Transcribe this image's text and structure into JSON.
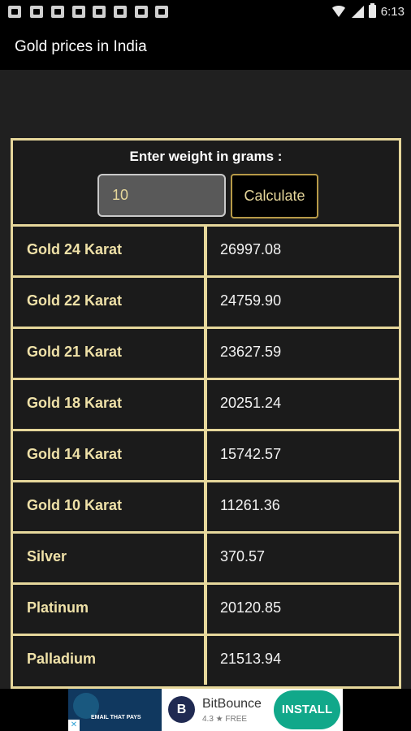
{
  "status_bar": {
    "time": "6:13",
    "left_icons": [
      "facebook-icon",
      "tool-icon",
      "tool-icon",
      "facebook-icon",
      "tool-icon",
      "image-icon",
      "facebook-icon",
      "facebook-icon"
    ]
  },
  "app_bar": {
    "title": "Gold prices in India"
  },
  "calculator": {
    "prompt": "Enter weight in grams :",
    "weight_value": "10",
    "calculate_label": "Calculate"
  },
  "prices": [
    {
      "metal": "Gold 24 Karat",
      "price": "26997.08"
    },
    {
      "metal": "Gold 22 Karat",
      "price": "24759.90"
    },
    {
      "metal": "Gold 21 Karat",
      "price": "23627.59"
    },
    {
      "metal": "Gold 18 Karat",
      "price": "20251.24"
    },
    {
      "metal": "Gold 14 Karat",
      "price": "15742.57"
    },
    {
      "metal": "Gold 10 Karat",
      "price": "11261.36"
    },
    {
      "metal": "Silver",
      "price": "370.57"
    },
    {
      "metal": "Platinum",
      "price": "20120.85"
    },
    {
      "metal": "Palladium",
      "price": "21513.94"
    }
  ],
  "ad": {
    "thumb_text": "EMAIL THAT PAYS",
    "app_name": "BitBounce",
    "rating_text": "4.3 ★ FREE",
    "install_label": "INSTALL",
    "logo_letter": "B"
  },
  "colors": {
    "accent_gold": "#e6d79b",
    "background": "#202020",
    "install_green": "#11a88a"
  }
}
